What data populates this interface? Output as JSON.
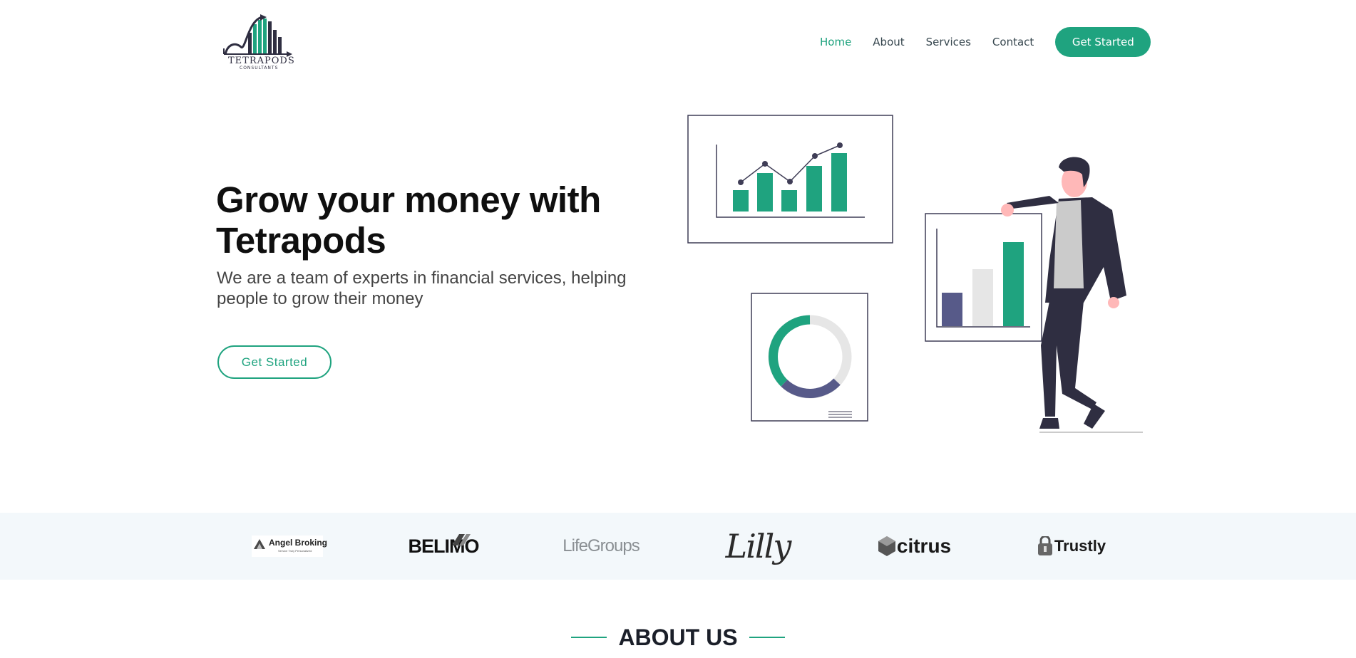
{
  "brand": {
    "logo_text": "TETRAPODS",
    "logo_subtext": "CONSULTANTS",
    "accent_color": "#1fa37f",
    "dark_color": "#2f2e41",
    "muted_color": "#575a89"
  },
  "nav": {
    "items": [
      {
        "label": "Home",
        "active": true
      },
      {
        "label": "About",
        "active": false
      },
      {
        "label": "Services",
        "active": false
      },
      {
        "label": "Contact",
        "active": false
      }
    ],
    "cta_label": "Get Started"
  },
  "hero": {
    "title": "Grow your money with Tetrapods",
    "subtitle": "We are a team of experts in financial services, helping people to grow their money",
    "cta_label": "Get Started"
  },
  "clients": {
    "logos": [
      {
        "name": "Angel Broking",
        "tagline": "Service Truly Personalized",
        "icon": "angel-logo"
      },
      {
        "name": "BELIMO",
        "icon": "belimo-logo"
      },
      {
        "name": "LifeGroups",
        "icon": "lifegroups-logo"
      },
      {
        "name": "Lilly",
        "icon": "lilly-logo"
      },
      {
        "name": "citrus",
        "icon": "citrus-logo"
      },
      {
        "name": "Trustly",
        "icon": "trustly-logo"
      }
    ]
  },
  "about": {
    "heading": "ABOUT US"
  }
}
